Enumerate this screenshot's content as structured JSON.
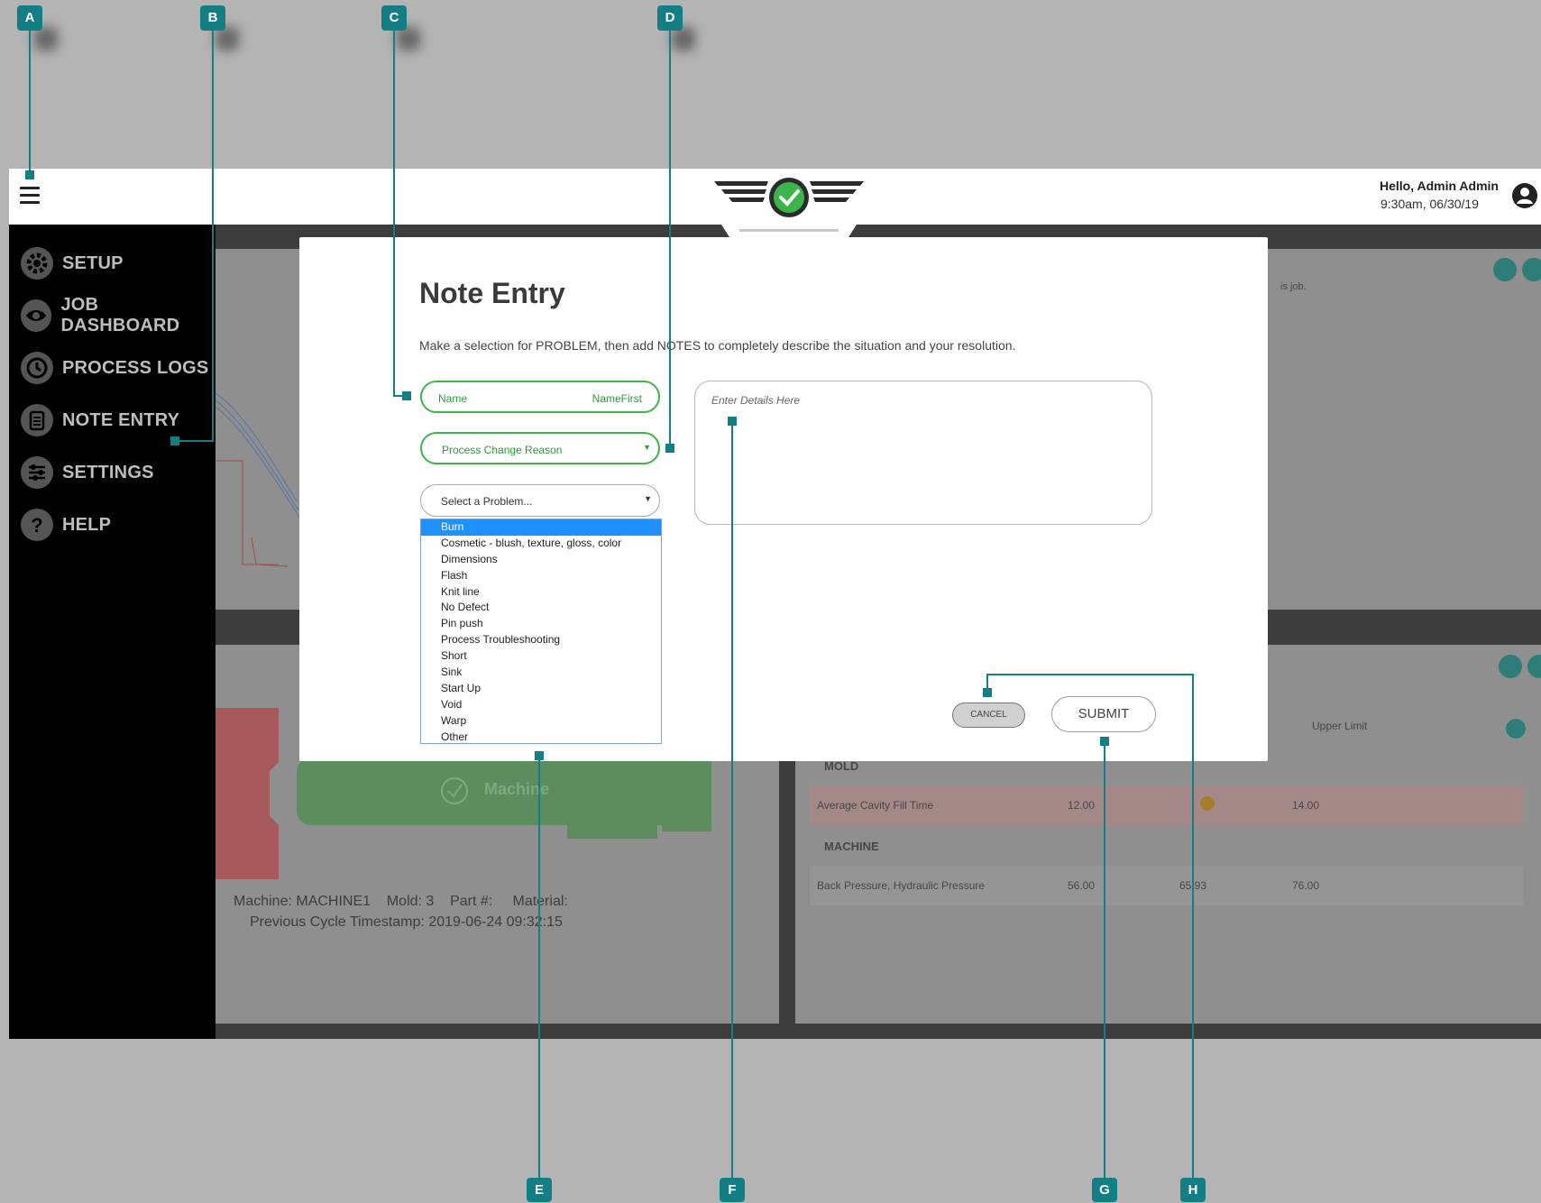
{
  "header": {
    "greeting": "Hello, Admin Admin",
    "datetime": "9:30am, 06/30/19"
  },
  "sidebar": {
    "items": [
      {
        "label": "SETUP",
        "icon": "gear-icon"
      },
      {
        "label": "JOB DASHBOARD",
        "icon": "eye-icon"
      },
      {
        "label": "PROCESS LOGS",
        "icon": "history-icon"
      },
      {
        "label": "NOTE ENTRY",
        "icon": "clipboard-icon"
      },
      {
        "label": "SETTINGS",
        "icon": "sliders-icon"
      },
      {
        "label": "HELP",
        "icon": "help-icon"
      }
    ]
  },
  "background": {
    "top_panel_text": "is job.",
    "upper_limit_header": "Upper Limit",
    "mold_section": "MOLD",
    "mold_row": {
      "name": "Average Cavity Fill Time",
      "low": "12.00",
      "high": "14.00"
    },
    "machine_section": "MACHINE",
    "machine_row": {
      "name": "Back Pressure, Hydraulic Pressure",
      "low": "56.00",
      "value": "65.93",
      "high": "76.00"
    },
    "machine_label": "Machine",
    "machine_info": {
      "machine_label": "Machine:",
      "machine": "MACHINE1",
      "mold_label": "Mold:",
      "mold": "3",
      "part_label": "Part #:",
      "material_label": "Material:",
      "timestamp_label": "Previous Cycle Timestamp:",
      "timestamp": "2019-06-24   09:32:15"
    }
  },
  "modal": {
    "title": "Note Entry",
    "instructions": "Make a selection for PROBLEM, then add NOTES to completely describe the situation and your resolution.",
    "name_field": {
      "label": "Name",
      "value": "NameFirst"
    },
    "reason_select": {
      "value": "Process Change Reason"
    },
    "problem_select": {
      "placeholder": "Select a Problem...",
      "selected": "Burn"
    },
    "problem_options": [
      "Burn",
      "Cosmetic - blush, texture, gloss, color",
      "Dimensions",
      "Flash",
      "Knit line",
      "No Defect",
      "Pin push",
      "Process Troubleshooting",
      "Short",
      "Sink",
      "Start Up",
      "Void",
      "Warp",
      "Other"
    ],
    "details": {
      "placeholder": "Enter Details Here"
    },
    "cancel_label": "CANCEL",
    "submit_label": "SUBMIT"
  },
  "callouts": [
    "A",
    "B",
    "C",
    "D",
    "E",
    "F",
    "G",
    "H"
  ],
  "colors": {
    "accent": "#137f85",
    "green": "#3bb54a",
    "selection": "#1e90ff"
  }
}
